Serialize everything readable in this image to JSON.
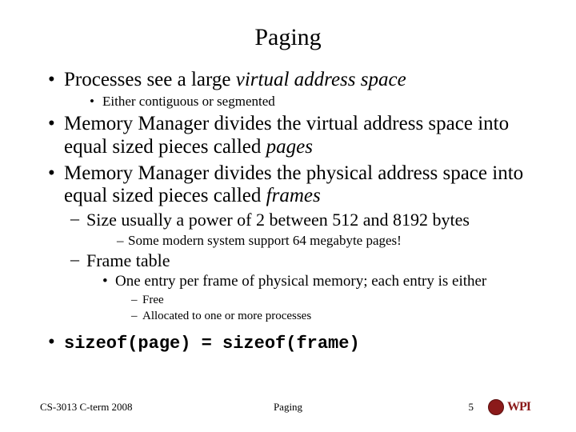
{
  "title": "Paging",
  "bullets": {
    "b1_pre": "Processes see a large ",
    "b1_em": "virtual address space",
    "b1s1": "Either contiguous or segmented",
    "b2_pre": "Memory Manager divides the virtual address space into equal sized pieces called ",
    "b2_em": "pages",
    "b3_pre": "Memory Manager divides the physical address space into equal sized pieces called ",
    "b3_em": "frames",
    "b3s1": "Size usually a power of 2 between 512 and 8192 bytes",
    "b3s1s1": "Some modern system support 64 megabyte pages!",
    "b3s2": "Frame table",
    "b3s2s1": "One entry per frame of physical memory; each entry is either",
    "b3s2s1a": "Free",
    "b3s2s1b": "Allocated to one or more processes",
    "b4code": "sizeof(page) = sizeof(frame)"
  },
  "footer": {
    "left": "CS-3013 C-term 2008",
    "center": "Paging",
    "pagenum": "5",
    "logo_text": "WPI"
  }
}
